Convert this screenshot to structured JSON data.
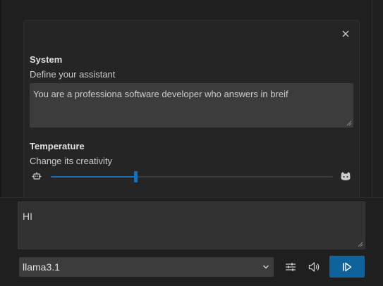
{
  "settings_panel": {
    "system": {
      "title": "System",
      "description": "Define your assistant",
      "value": "You are a professiona software developer who answers in breif"
    },
    "temperature": {
      "title": "Temperature",
      "description": "Change its creativity",
      "level_fraction": 0.3
    },
    "icons": {
      "close": "close-icon",
      "left": "robot-icon",
      "right": "cat-icon"
    }
  },
  "chat": {
    "input_value": "HI",
    "model": "llama3.1",
    "icons": {
      "settings": "sliders-icon",
      "speaker": "speaker-icon",
      "send": "send-icon"
    }
  },
  "colors": {
    "accent": "#0e639c",
    "slider": "#1a6fb4",
    "background": "#1f1f1f",
    "panel": "#252526"
  }
}
